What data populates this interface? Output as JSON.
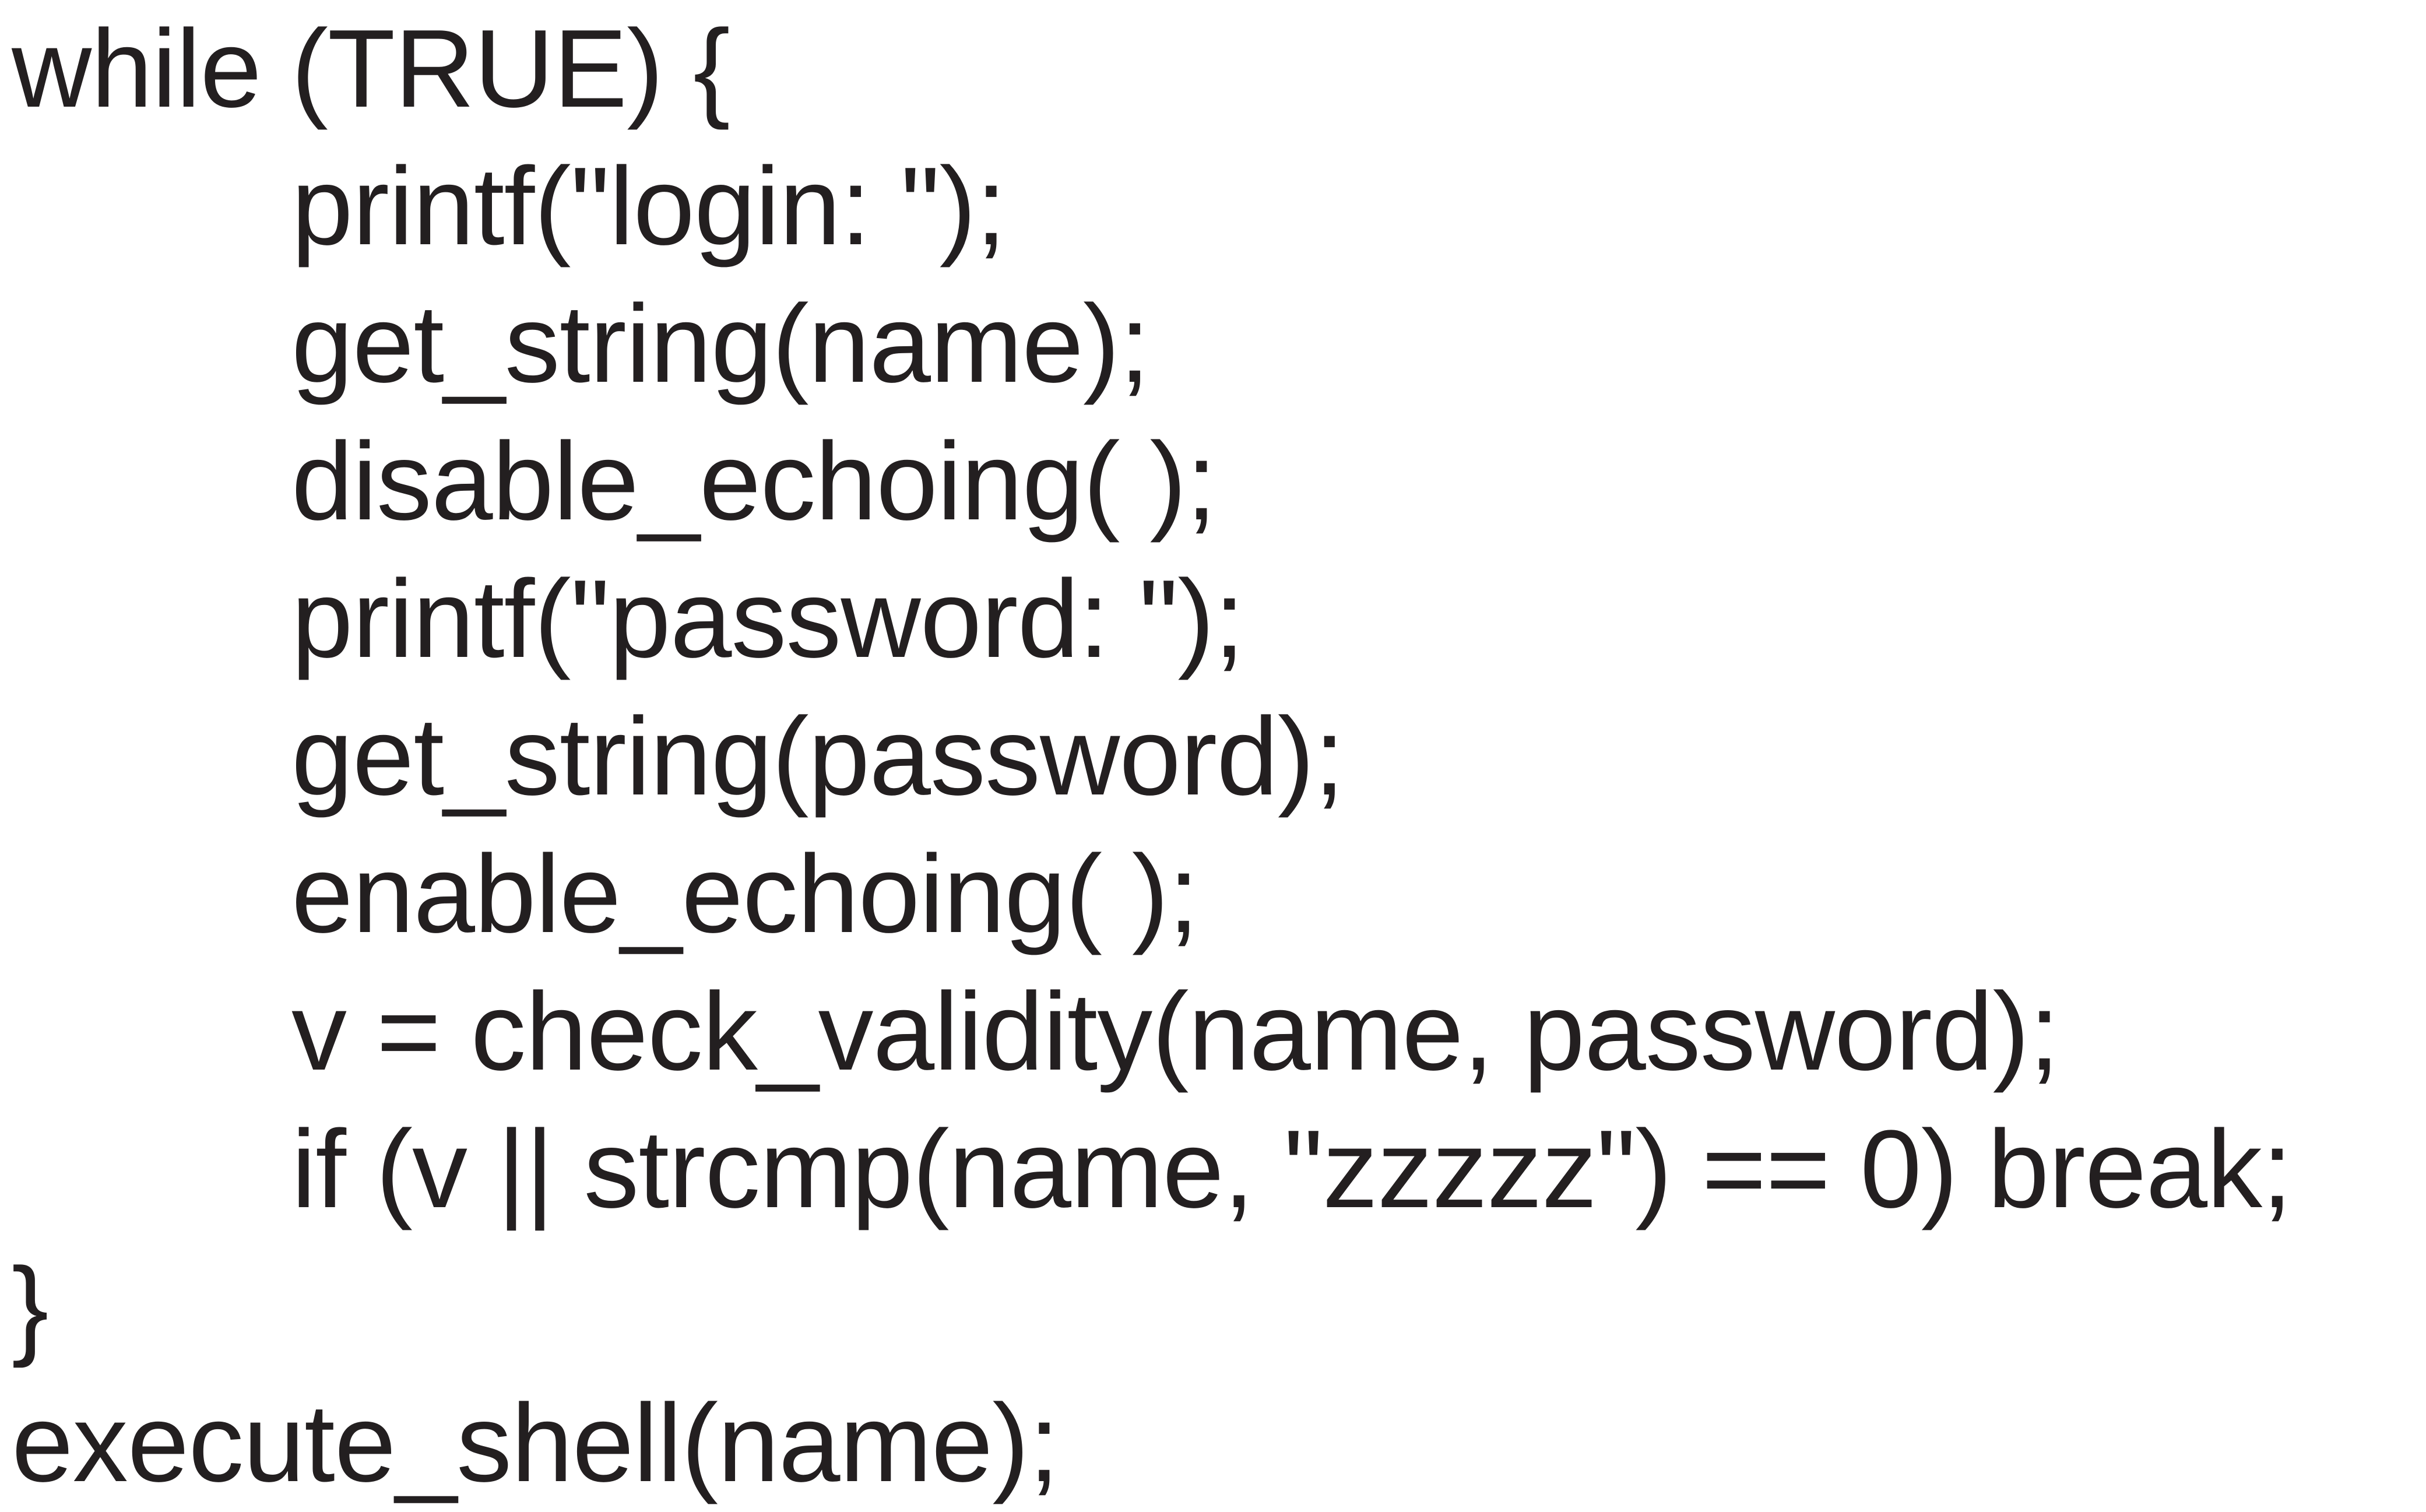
{
  "code_figure": {
    "lines": [
      "while (TRUE) {",
      "printf(\"login: \");",
      "get_string(name);",
      "disable_echoing( );",
      "printf(\"password: \");",
      "get_string(password);",
      "enable_echoing( );",
      "v = check_validity(name, password);",
      "if (v || strcmp(name, \"zzzzz\") == 0) break;",
      "}",
      "execute_shell(name);"
    ]
  },
  "colors": {
    "background": "#ffffff",
    "text": "#231f20"
  }
}
